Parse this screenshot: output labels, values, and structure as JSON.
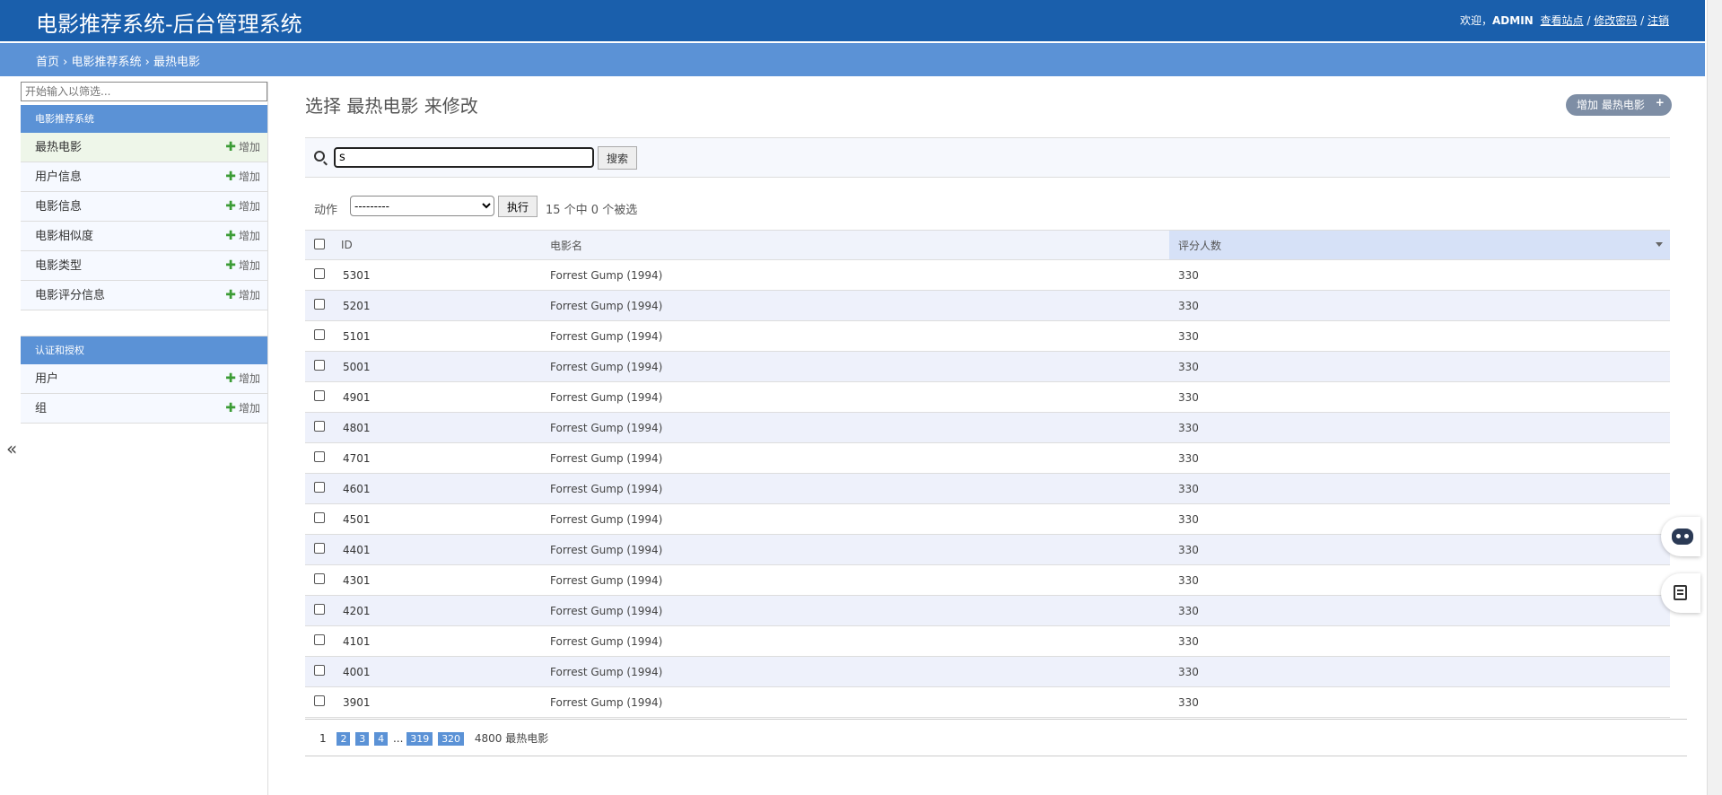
{
  "header": {
    "brand": "电影推荐系统-后台管理系统",
    "welcome": "欢迎，",
    "username": "ADMIN",
    "view_site": "查看站点",
    "change_password": "修改密码",
    "logout": "注销",
    "separator": "/"
  },
  "breadcrumbs": {
    "home": "首页",
    "app": "电影推荐系统",
    "current": "最热电影",
    "sep": "›"
  },
  "sidebar": {
    "filter_placeholder": "开始输入以筛选...",
    "add_label": "增加",
    "add_icon": "plus-icon",
    "modules": [
      {
        "caption": "电影推荐系统",
        "items": [
          {
            "label": "最热电影"
          },
          {
            "label": "用户信息"
          },
          {
            "label": "电影信息"
          },
          {
            "label": "电影相似度"
          },
          {
            "label": "电影类型"
          },
          {
            "label": "电影评分信息"
          }
        ]
      },
      {
        "caption": "认证和授权",
        "items": [
          {
            "label": "用户"
          },
          {
            "label": "组"
          }
        ]
      }
    ],
    "toggle": "«"
  },
  "content": {
    "title": "选择 最热电影 来修改",
    "add_button": "增加 最热电影",
    "add_plus": "+",
    "search_value": "s",
    "search_button": "搜索",
    "action_label": "动作",
    "action_selected": "---------",
    "go_button": "执行",
    "counter": "15 个中 0 个被选",
    "columns": [
      "ID",
      "电影名",
      "评分人数"
    ],
    "rows": [
      {
        "id": "5301",
        "name": "Forrest Gump (1994)",
        "count": "330"
      },
      {
        "id": "5201",
        "name": "Forrest Gump (1994)",
        "count": "330"
      },
      {
        "id": "5101",
        "name": "Forrest Gump (1994)",
        "count": "330"
      },
      {
        "id": "5001",
        "name": "Forrest Gump (1994)",
        "count": "330"
      },
      {
        "id": "4901",
        "name": "Forrest Gump (1994)",
        "count": "330"
      },
      {
        "id": "4801",
        "name": "Forrest Gump (1994)",
        "count": "330"
      },
      {
        "id": "4701",
        "name": "Forrest Gump (1994)",
        "count": "330"
      },
      {
        "id": "4601",
        "name": "Forrest Gump (1994)",
        "count": "330"
      },
      {
        "id": "4501",
        "name": "Forrest Gump (1994)",
        "count": "330"
      },
      {
        "id": "4401",
        "name": "Forrest Gump (1994)",
        "count": "330"
      },
      {
        "id": "4301",
        "name": "Forrest Gump (1994)",
        "count": "330"
      },
      {
        "id": "4201",
        "name": "Forrest Gump (1994)",
        "count": "330"
      },
      {
        "id": "4101",
        "name": "Forrest Gump (1994)",
        "count": "330"
      },
      {
        "id": "4001",
        "name": "Forrest Gump (1994)",
        "count": "330"
      },
      {
        "id": "3901",
        "name": "Forrest Gump (1994)",
        "count": "330"
      }
    ],
    "pagination": {
      "current": "1",
      "pages": [
        "2",
        "3",
        "4"
      ],
      "ellipsis": "...",
      "last_pages": [
        "319",
        "320"
      ],
      "total": "4800 最热电影"
    }
  },
  "colors": {
    "header": "#1a5fac",
    "breadcrumb": "#5b92d6",
    "module_caption": "#5b92d6",
    "sorted_header": "#d6e1f7",
    "add_green": "#3c9c36"
  }
}
